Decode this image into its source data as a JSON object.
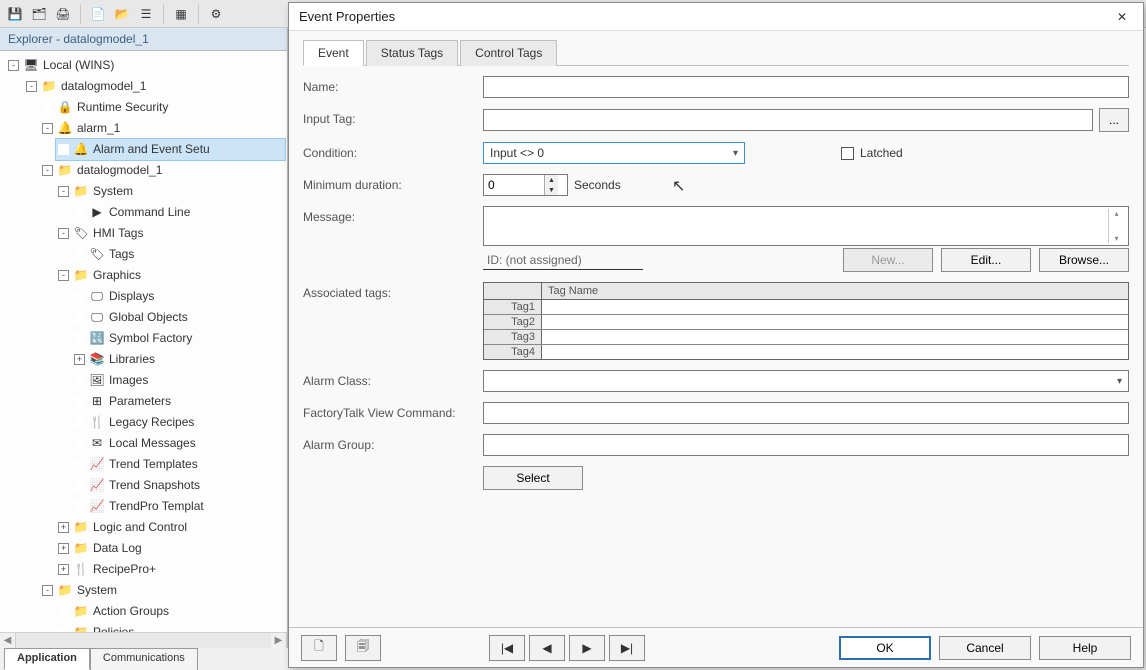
{
  "explorer": {
    "title": "Explorer - datalogmodel_1",
    "tree": {
      "root": "Local (WINS)",
      "items": [
        {
          "label": "datalogmodel_1",
          "level": 1,
          "exp": "-"
        },
        {
          "label": "Runtime Security",
          "level": 2,
          "exp": "none"
        },
        {
          "label": "alarm_1",
          "level": 2,
          "exp": "-"
        },
        {
          "label": "Alarm and Event Setu",
          "level": 3,
          "exp": "none",
          "sel": true
        },
        {
          "label": "datalogmodel_1",
          "level": 2,
          "exp": "-"
        },
        {
          "label": "System",
          "level": 3,
          "exp": "-"
        },
        {
          "label": "Command Line",
          "level": 4,
          "exp": "none"
        },
        {
          "label": "HMI Tags",
          "level": 3,
          "exp": "-"
        },
        {
          "label": "Tags",
          "level": 4,
          "exp": "none"
        },
        {
          "label": "Graphics",
          "level": 3,
          "exp": "-"
        },
        {
          "label": "Displays",
          "level": 4,
          "exp": "none"
        },
        {
          "label": "Global Objects",
          "level": 4,
          "exp": "none"
        },
        {
          "label": "Symbol Factory",
          "level": 4,
          "exp": "none"
        },
        {
          "label": "Libraries",
          "level": 4,
          "exp": "+"
        },
        {
          "label": "Images",
          "level": 4,
          "exp": "none"
        },
        {
          "label": "Parameters",
          "level": 4,
          "exp": "none"
        },
        {
          "label": "Legacy Recipes",
          "level": 4,
          "exp": "none"
        },
        {
          "label": "Local Messages",
          "level": 4,
          "exp": "none"
        },
        {
          "label": "Trend Templates",
          "level": 4,
          "exp": "none"
        },
        {
          "label": "Trend Snapshots",
          "level": 4,
          "exp": "none"
        },
        {
          "label": "TrendPro Templat",
          "level": 4,
          "exp": "none"
        },
        {
          "label": "Logic and Control",
          "level": 3,
          "exp": "+"
        },
        {
          "label": "Data Log",
          "level": 3,
          "exp": "+"
        },
        {
          "label": "RecipePro+",
          "level": 3,
          "exp": "+"
        },
        {
          "label": "System",
          "level": 2,
          "exp": "-"
        },
        {
          "label": "Action Groups",
          "level": 3,
          "exp": "none"
        },
        {
          "label": "Policies",
          "level": 3,
          "exp": "none"
        }
      ]
    }
  },
  "bottom_tabs": {
    "active": "Application",
    "other": "Communications"
  },
  "dialog": {
    "title": "Event Properties",
    "tabs": [
      "Event",
      "Status Tags",
      "Control Tags"
    ],
    "active_tab": "Event",
    "labels": {
      "name": "Name:",
      "input_tag": "Input Tag:",
      "condition": "Condition:",
      "min_dur": "Minimum duration:",
      "seconds": "Seconds",
      "latched": "Latched",
      "message": "Message:",
      "id_prefix": "ID: ",
      "id_value": "(not assigned)",
      "new": "New...",
      "edit": "Edit...",
      "browse": "Browse...",
      "assoc": "Associated tags:",
      "tagname_col": "Tag Name",
      "alarm_class": "Alarm Class:",
      "ft_cmd": "FactoryTalk View Command:",
      "alarm_group": "Alarm Group:",
      "select": "Select",
      "ok": "OK",
      "cancel": "Cancel",
      "help": "Help",
      "browse_btn": "..."
    },
    "values": {
      "name": "",
      "input_tag": "",
      "condition": "Input <> 0",
      "min_duration": "0",
      "message": "",
      "alarm_class": "",
      "ft_command": "",
      "alarm_group": ""
    },
    "tag_rows": [
      "Tag1",
      "Tag2",
      "Tag3",
      "Tag4"
    ]
  }
}
